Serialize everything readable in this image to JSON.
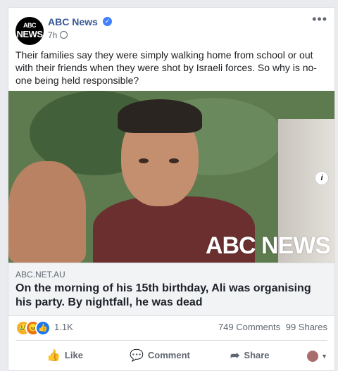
{
  "post": {
    "page_name": "ABC News",
    "avatar_mark": "ABC",
    "avatar_text": "NEWS",
    "time": "7h",
    "more_label": "•••",
    "text": "Their families say they were simply walking home from school or out with their friends when they were shot by Israeli forces. So why is no-one being held responsible?"
  },
  "image": {
    "watermark": "ABC NEWS",
    "info_label": "i"
  },
  "link": {
    "domain": "ABC.NET.AU",
    "title": "On the morning of his 15th birthday, Ali was organising his party. By nightfall, he was dead"
  },
  "stats": {
    "reaction_count": "1.1K",
    "comments": "749 Comments",
    "shares": "99 Shares",
    "reaction_icons": [
      "sad-reaction-icon",
      "angry-reaction-icon",
      "like-reaction-icon"
    ]
  },
  "actions": {
    "like": "Like",
    "comment": "Comment",
    "share": "Share"
  },
  "colors": {
    "brand_blue": "#385898",
    "facebook_blue": "#1877f2",
    "background": "#e9ebee"
  }
}
